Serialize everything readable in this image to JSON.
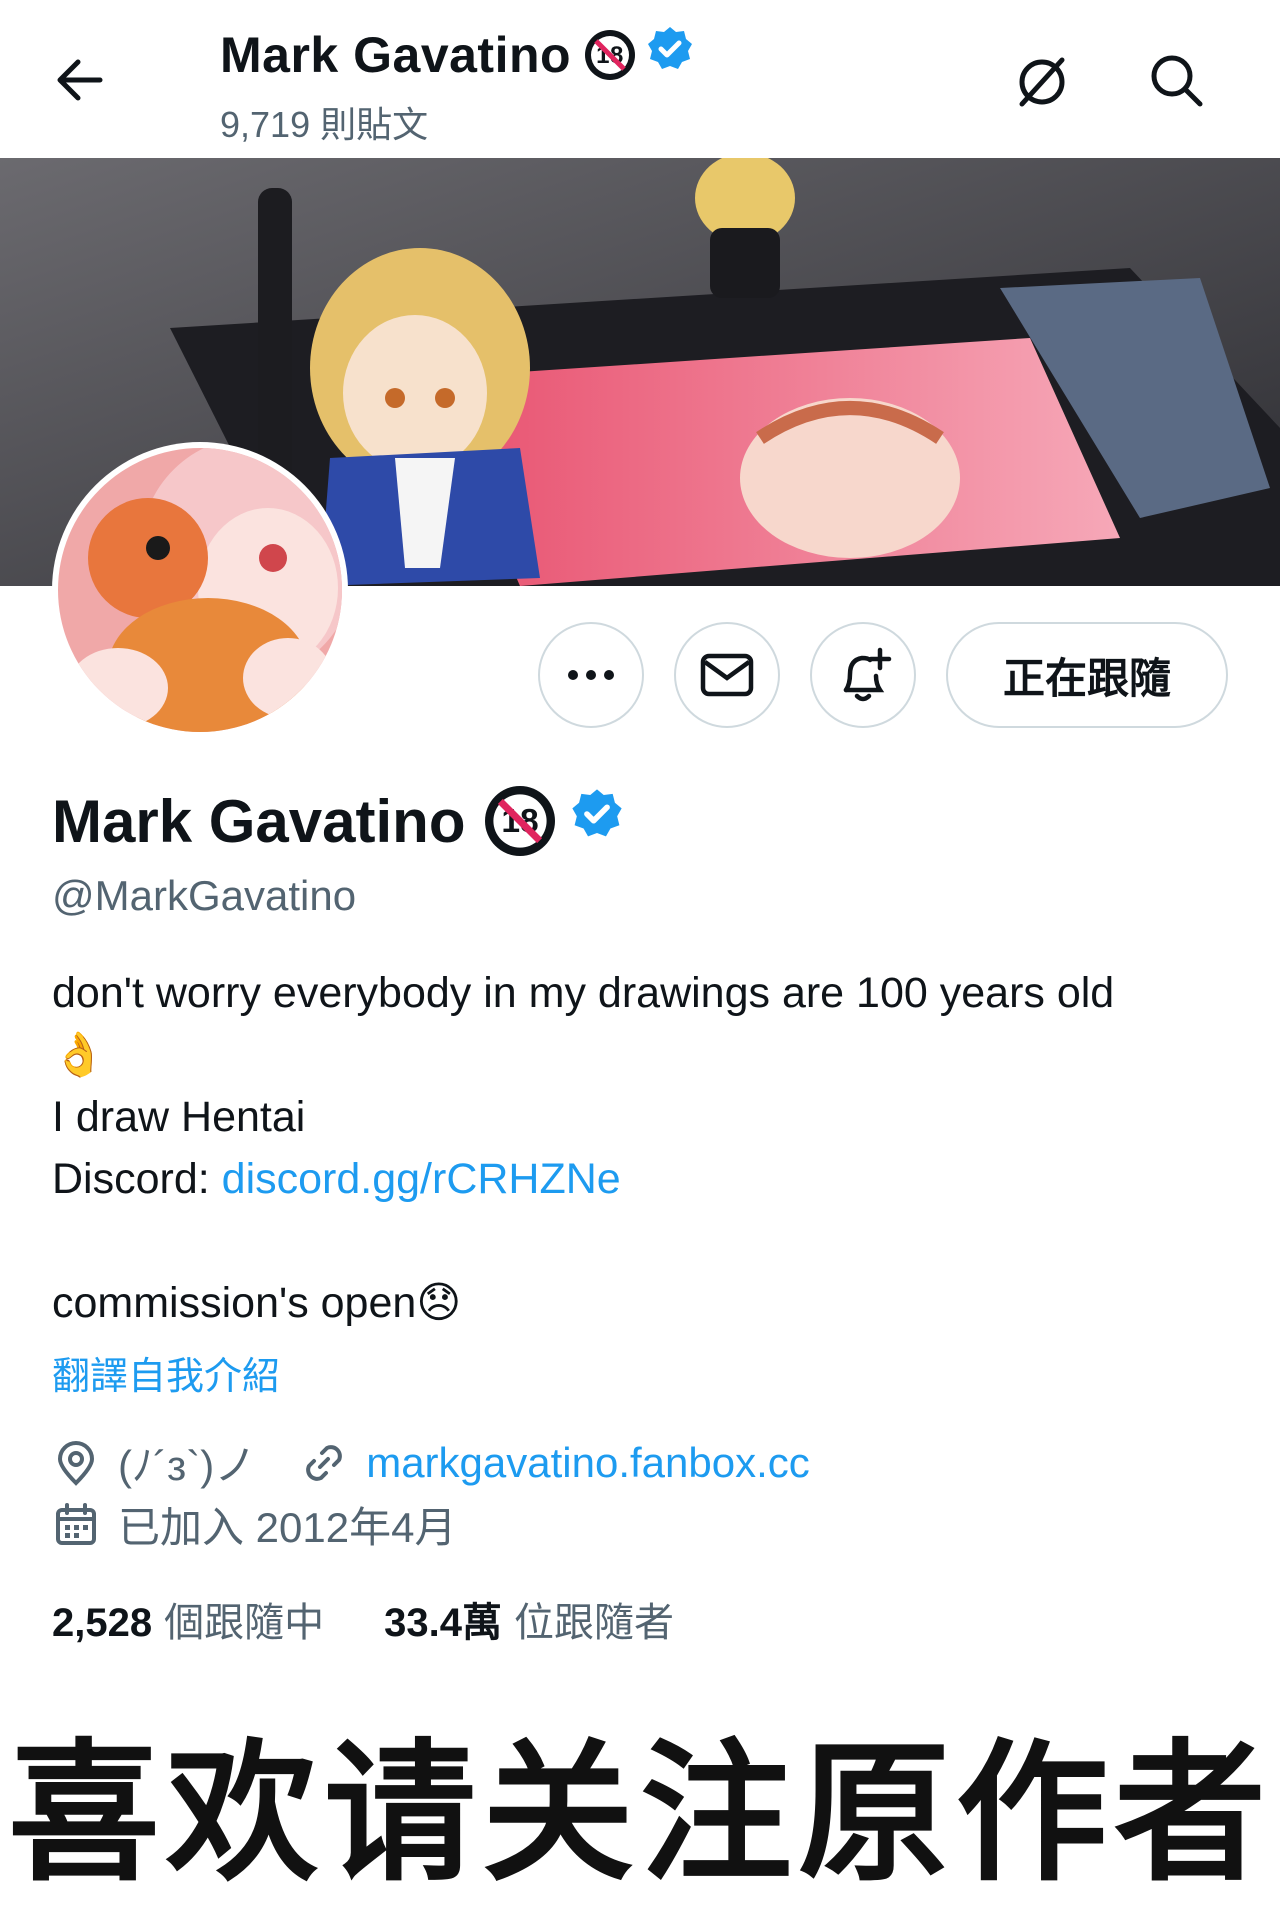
{
  "header": {
    "name": "Mark Gavatino",
    "posts_count": "9,719 則貼文"
  },
  "icons": {
    "back": "arrow-left-icon",
    "grok": "grok-icon",
    "search": "search-icon",
    "more": "more-icon",
    "message": "envelope-icon",
    "notify": "bell-plus-icon",
    "adult": "no-18-badge-icon",
    "verified": "verified-badge-icon",
    "location": "location-pin-icon",
    "link": "link-icon",
    "calendar": "calendar-icon"
  },
  "badges": {
    "adult_text": "18"
  },
  "actions": {
    "follow_label": "正在跟隨"
  },
  "profile": {
    "name": "Mark Gavatino",
    "handle": "@MarkGavatino",
    "bio": {
      "line1": "don't worry everybody in my drawings are 100 years old",
      "line1_emoji": "👌",
      "line2": "I draw Hentai",
      "line3_prefix": "Discord: ",
      "line3_link": "discord.gg/rCRHZNe",
      "line4": "commission's open",
      "line4_emoji": "😞"
    },
    "translate_bio": "翻譯自我介紹",
    "location": "(ﾉ´з`)ノ",
    "website": "markgavatino.fanbox.cc",
    "joined": "已加入 2012年4月",
    "following_count": "2,528",
    "following_label": "個跟隨中",
    "followers_count": "33.4萬",
    "followers_label": "位跟隨者"
  },
  "caption": "喜欢请关注原作者",
  "colors": {
    "accent": "#1d9bf0",
    "text": "#0f1419",
    "secondary": "#536471",
    "border": "#cfd9de"
  }
}
